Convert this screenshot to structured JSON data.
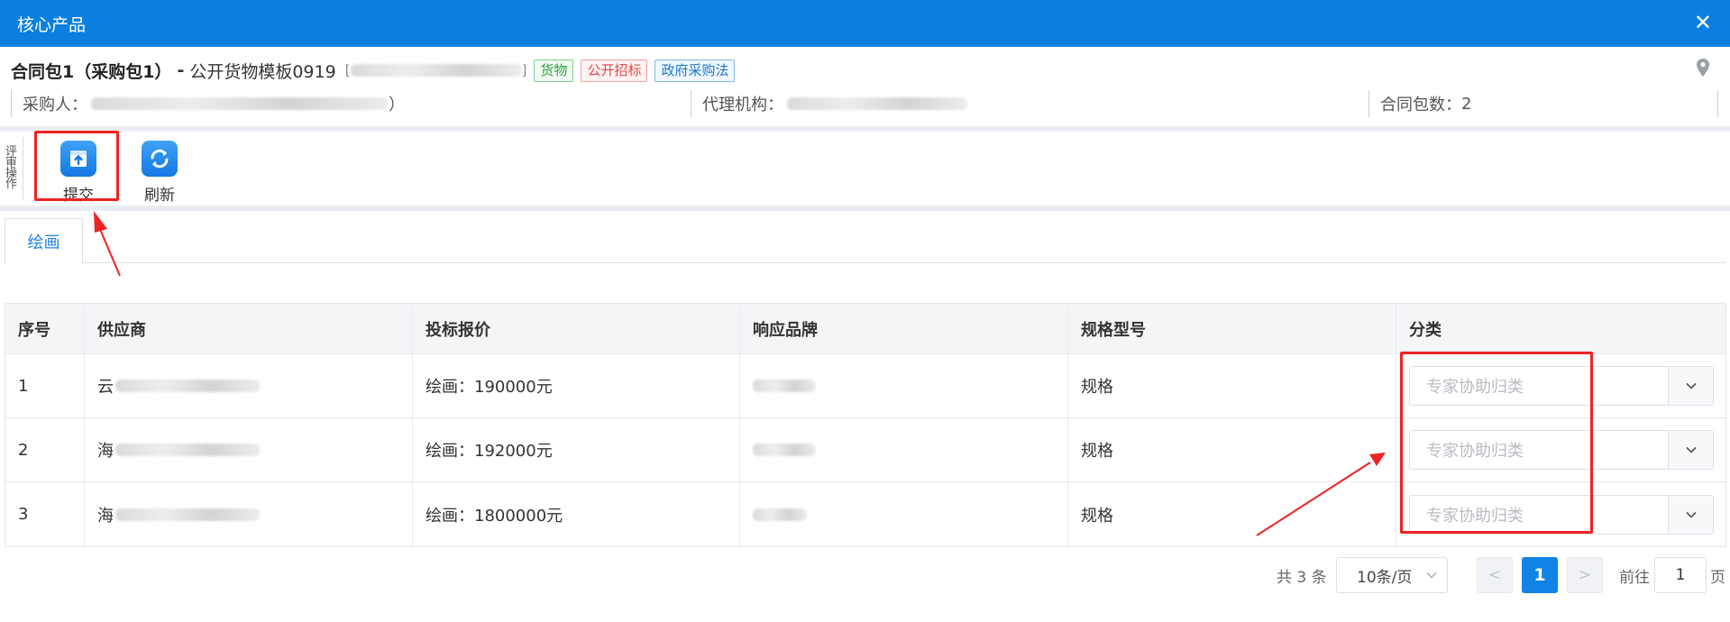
{
  "window": {
    "title": "核心产品",
    "close_symbol": "✕"
  },
  "package": {
    "title": "合同包1（采购包1）",
    "separator": "-",
    "name": "公开货物模板0919",
    "code_bracket_open": "[",
    "code_bracket_close": "]",
    "tags": [
      "货物",
      "公开招标",
      "政府采购法"
    ]
  },
  "meta": {
    "purchaser_label": "采购人：",
    "purchaser_close": "）",
    "agency_label": "代理机构：",
    "packages_label": "合同包数：",
    "packages_count": "2"
  },
  "toolbar": {
    "group_label": [
      "评",
      "审",
      "操",
      "作"
    ],
    "submit_label": "提交",
    "refresh_label": "刷新"
  },
  "tabs": [
    {
      "label": "绘画"
    }
  ],
  "table": {
    "headers": [
      "序号",
      "供应商",
      "投标报价",
      "响应品牌",
      "规格型号",
      "分类"
    ],
    "rows": [
      {
        "index": "1",
        "supplier": "云",
        "price": "绘画：190000元",
        "brand": "",
        "spec": "规格",
        "category_placeholder": "专家协助归类"
      },
      {
        "index": "2",
        "supplier": "海",
        "price": "绘画：192000元",
        "brand": "",
        "spec": "规格",
        "category_placeholder": "专家协助归类"
      },
      {
        "index": "3",
        "supplier": "海",
        "price": "绘画：1800000元",
        "brand": "",
        "spec": "规格",
        "category_placeholder": "专家协助归类"
      }
    ]
  },
  "pagination": {
    "total_text": "共 3 条",
    "page_size": "10条/页",
    "prev": "<",
    "current_page": "1",
    "next": ">",
    "goto_label": "前往",
    "goto_value": "1",
    "goto_suffix": "页"
  },
  "colors": {
    "header_bar": "#0a7fe0",
    "accent": "#1283e6",
    "annotation": "#ee2323"
  }
}
